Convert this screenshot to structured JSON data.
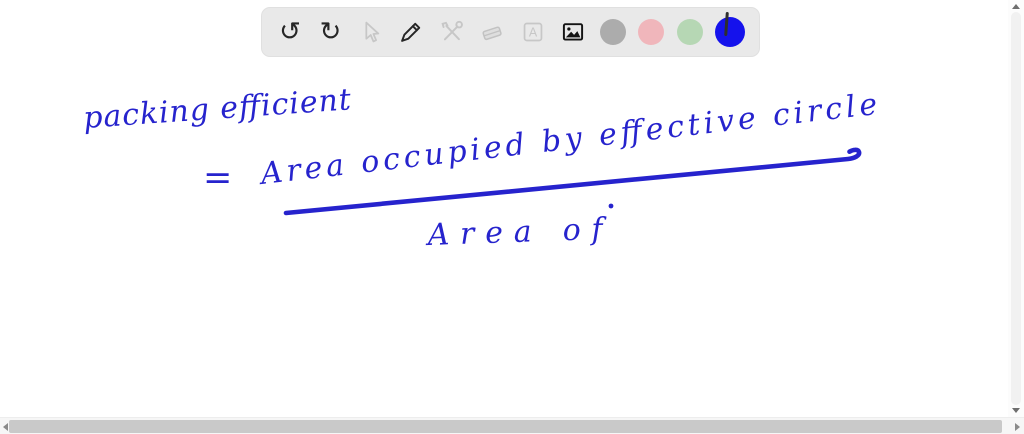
{
  "toolbar": {
    "undo_glyph": "↺",
    "redo_glyph": "↻",
    "text_tool_glyph": "A",
    "enabled_icon_color": "#262626",
    "disabled_icon_color": "#c7c7c7",
    "background": "#e9e9e9",
    "swatches": [
      {
        "name": "gray",
        "hex": "#acacac",
        "selected": false
      },
      {
        "name": "pink",
        "hex": "#f0b6bb",
        "selected": false
      },
      {
        "name": "green",
        "hex": "#b6d7b4",
        "selected": false
      },
      {
        "name": "blue",
        "hex": "#1512ec",
        "selected": true
      }
    ]
  },
  "canvas": {
    "ink_color": "#2623cd",
    "handwriting": {
      "title": "packing efficient",
      "equals": "=",
      "numerator": "Area occupied by effective circle",
      "denominator": "Area of"
    }
  }
}
